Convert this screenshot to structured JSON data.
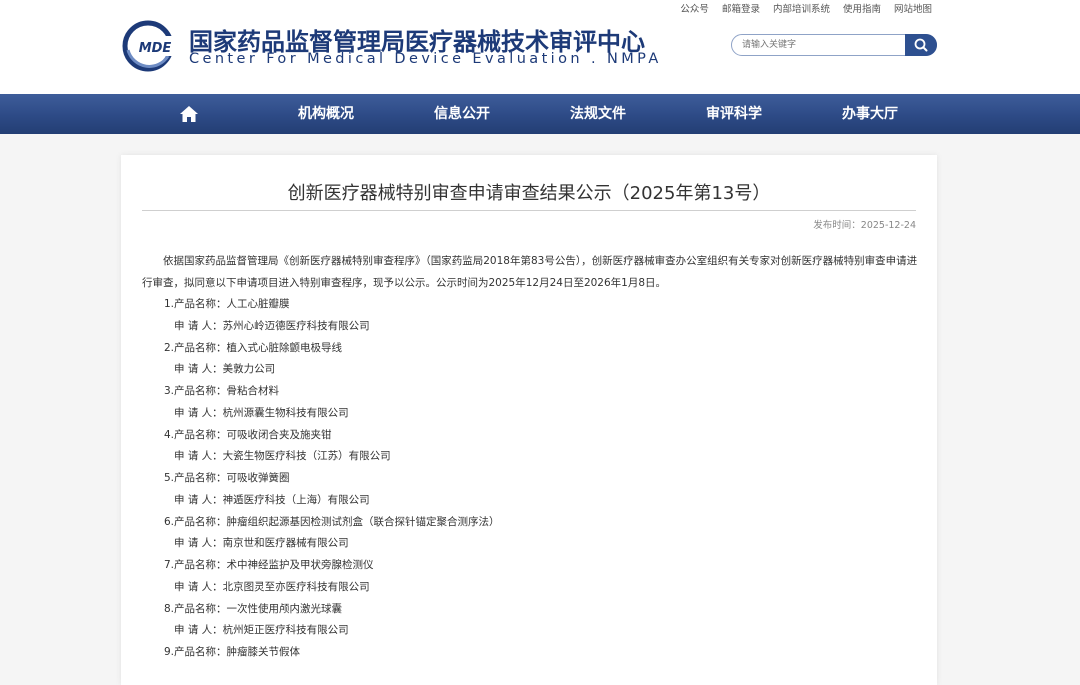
{
  "header": {
    "top_links": [
      "公众号",
      "邮箱登录",
      "内部培训系统",
      "使用指南",
      "网站地图"
    ],
    "logo_abbr": "MDE",
    "logo_title_cn": "国家药品监督管理局医疗器械技术审评中心",
    "logo_title_en": "Center For Medical Device Evaluation . NMPA",
    "search_placeholder": "请输入关键字",
    "brand_color": "#1d3a78"
  },
  "nav": {
    "items": [
      "机构概况",
      "信息公开",
      "法规文件",
      "审评科学",
      "办事大厅"
    ]
  },
  "article": {
    "title": "创新医疗器械特别审查申请审查结果公示（2025年第13号）",
    "publish_time": "发布时间：2025-12-24",
    "intro": "依据国家药品监督管理局《创新医疗器械特别审查程序》（国家药监局2018年第83号公告），创新医疗器械审查办公室组织有关专家对创新医疗器械特别审查申请进行审查，拟同意以下申请项目进入特别审查程序，现予以公示。公示时间为2025年12月24日至2026年1月8日。",
    "entries": [
      {
        "product": "1.产品名称：人工心脏瓣膜",
        "applicant": "申 请 人：苏州心岭迈德医疗科技有限公司"
      },
      {
        "product": "2.产品名称：植入式心脏除颤电极导线",
        "applicant": "申 请 人：美敦力公司"
      },
      {
        "product": "3.产品名称：骨粘合材料",
        "applicant": "申 请 人：杭州源囊生物科技有限公司"
      },
      {
        "product": "4.产品名称：可吸收闭合夹及施夹钳",
        "applicant": "申 请 人：大瓷生物医疗科技（江苏）有限公司"
      },
      {
        "product": "5.产品名称：可吸收弹簧圈",
        "applicant": "申 请 人：神遁医疗科技（上海）有限公司"
      },
      {
        "product": "6.产品名称：肿瘤组织起源基因检测试剂盒（联合探针锚定聚合测序法）",
        "applicant": "申 请 人：南京世和医疗器械有限公司"
      },
      {
        "product": "7.产品名称：术中神经监护及甲状旁腺检测仪",
        "applicant": "申 请 人：北京图灵至亦医疗科技有限公司"
      },
      {
        "product": "8.产品名称：一次性使用颅内激光球囊",
        "applicant": "申 请 人：杭州矩正医疗科技有限公司"
      },
      {
        "product": "9.产品名称：肿瘤膝关节假体",
        "applicant": ""
      }
    ]
  }
}
